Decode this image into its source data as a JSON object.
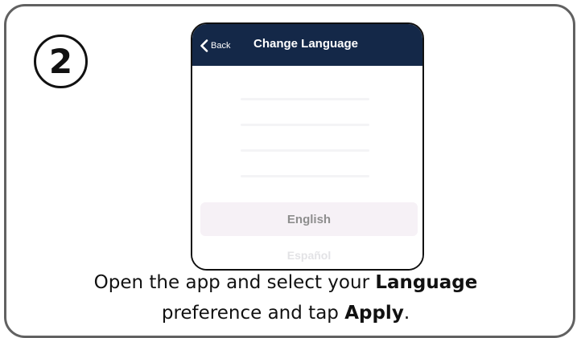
{
  "step": {
    "number": "2"
  },
  "phone": {
    "navbar": {
      "back_label": "Back",
      "title": "Change Language"
    },
    "languages": {
      "selected": "English",
      "next": "Español"
    }
  },
  "caption": {
    "line1_prefix": "Open the app and select your ",
    "line1_bold": "Language",
    "line2_prefix": "preference and tap ",
    "line2_bold": "Apply",
    "line2_suffix": "."
  },
  "colors": {
    "navbar": "#142848",
    "border": "#616161",
    "selected_row": "#f6f1f6"
  }
}
